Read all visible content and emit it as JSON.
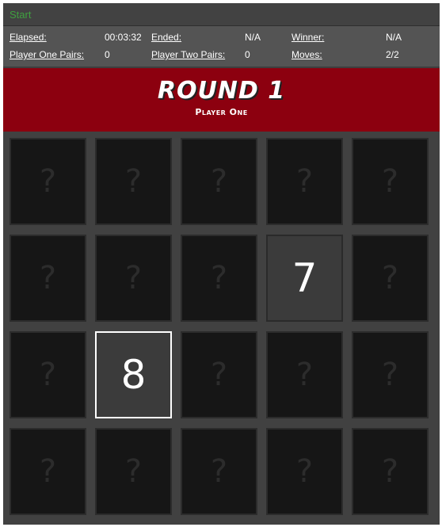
{
  "topbar": {
    "start_label": "Start"
  },
  "stats": {
    "elapsed_label": "Elapsed:",
    "elapsed_value": "00:03:32",
    "ended_label": "Ended:",
    "ended_value": "N/A",
    "winner_label": "Winner:",
    "winner_value": "N/A",
    "p1_pairs_label": "Player One Pairs:",
    "p1_pairs_value": "0",
    "p2_pairs_label": "Player Two Pairs:",
    "p2_pairs_value": "0",
    "moves_label": "Moves:",
    "moves_value": "2/2"
  },
  "banner": {
    "round_title": "ROUND 1",
    "player_turn": "Player One"
  },
  "colors": {
    "start_link": "#3fa03f",
    "banner_bg": "#8c000f",
    "card_back": "#161616",
    "card_face": "#3b3b3b",
    "selected_border": "#ffffff"
  },
  "board": {
    "rows": 4,
    "cols": 5,
    "hidden_glyph": "?",
    "cards": [
      {
        "state": "hidden",
        "value": "?"
      },
      {
        "state": "hidden",
        "value": "?"
      },
      {
        "state": "hidden",
        "value": "?"
      },
      {
        "state": "hidden",
        "value": "?"
      },
      {
        "state": "hidden",
        "value": "?"
      },
      {
        "state": "hidden",
        "value": "?"
      },
      {
        "state": "hidden",
        "value": "?"
      },
      {
        "state": "hidden",
        "value": "?"
      },
      {
        "state": "flipped",
        "value": "7"
      },
      {
        "state": "hidden",
        "value": "?"
      },
      {
        "state": "hidden",
        "value": "?"
      },
      {
        "state": "flipped-selected",
        "value": "8"
      },
      {
        "state": "hidden",
        "value": "?"
      },
      {
        "state": "hidden",
        "value": "?"
      },
      {
        "state": "hidden",
        "value": "?"
      },
      {
        "state": "hidden",
        "value": "?"
      },
      {
        "state": "hidden",
        "value": "?"
      },
      {
        "state": "hidden",
        "value": "?"
      },
      {
        "state": "hidden",
        "value": "?"
      },
      {
        "state": "hidden",
        "value": "?"
      }
    ]
  }
}
